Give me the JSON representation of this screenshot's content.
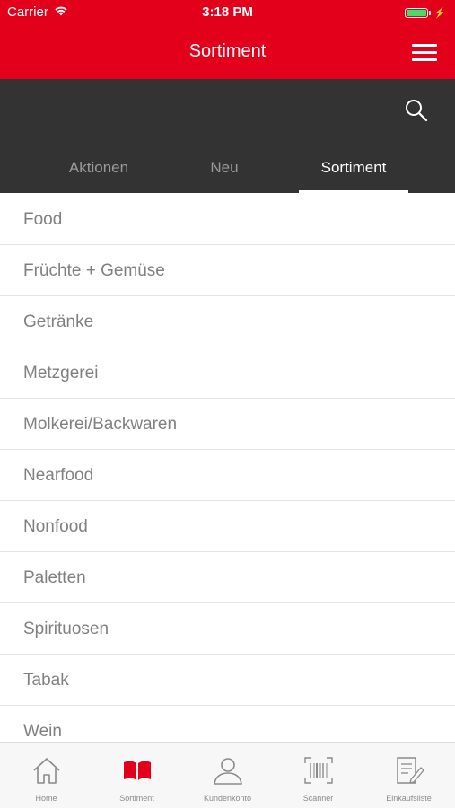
{
  "status_bar": {
    "carrier": "Carrier",
    "time": "3:18 PM",
    "battery_color": "#4cd964"
  },
  "header": {
    "title": "Sortiment",
    "color": "#e2001a",
    "menu_icon": "hamburger-icon"
  },
  "search": {
    "icon": "search-icon"
  },
  "tabs": [
    {
      "label": "Aktionen",
      "active": false
    },
    {
      "label": "Neu",
      "active": false
    },
    {
      "label": "Sortiment",
      "active": true
    }
  ],
  "list": {
    "items": [
      "Food",
      "Früchte + Gemüse",
      "Getränke",
      "Metzgerei",
      "Molkerei/Backwaren",
      "Nearfood",
      "Nonfood",
      "Paletten",
      "Spirituosen",
      "Tabak",
      "Wein"
    ]
  },
  "tab_bar": {
    "items": [
      {
        "label": "Home",
        "icon": "home-icon",
        "active": false
      },
      {
        "label": "Sortiment",
        "icon": "book-icon",
        "active": true
      },
      {
        "label": "Kundenkonto",
        "icon": "user-icon",
        "active": false
      },
      {
        "label": "Scanner",
        "icon": "barcode-icon",
        "active": false
      },
      {
        "label": "Einkaufsliste",
        "icon": "notepad-icon",
        "active": false
      }
    ],
    "active_color": "#e2001a"
  }
}
